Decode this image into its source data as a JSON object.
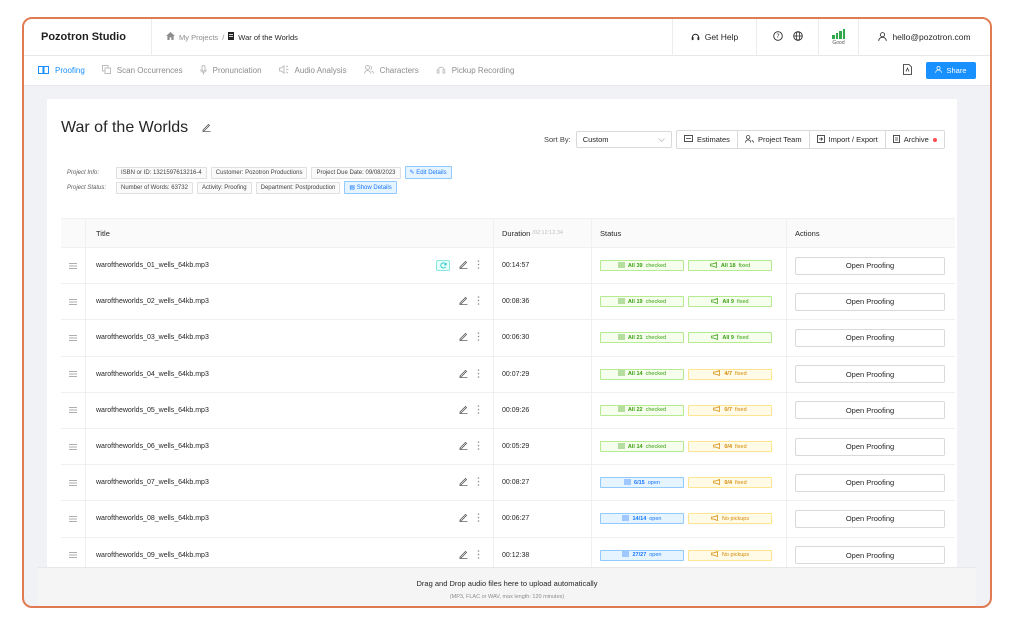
{
  "app": {
    "brand": "Pozotron Studio"
  },
  "breadcrumb": {
    "parent": "My Projects",
    "separator": "/",
    "current": "War of the Worlds"
  },
  "header": {
    "help_label": "Get Help",
    "signal_label": "Good",
    "user_email": "hello@pozotron.com"
  },
  "nav": {
    "items": [
      {
        "label": "Proofing",
        "icon": "book-icon",
        "active": true
      },
      {
        "label": "Scan Occurrences",
        "icon": "copy-icon",
        "active": false
      },
      {
        "label": "Pronunciation",
        "icon": "microphone-icon",
        "active": false
      },
      {
        "label": "Audio Analysis",
        "icon": "speaker-icon",
        "active": false
      },
      {
        "label": "Characters",
        "icon": "users-icon",
        "active": false
      },
      {
        "label": "Pickup Recording",
        "icon": "headphones-icon",
        "active": false
      }
    ],
    "share_label": "Share"
  },
  "project": {
    "title": "War of the Worlds",
    "info_label": "Project Info:",
    "info_tags": [
      "ISBN or ID: 1321597613216-4",
      "Customer: Pozotron Productions",
      "Project Due Date: 09/08/2023"
    ],
    "edit_details_label": "Edit Details",
    "status_label": "Project Status:",
    "status_tags": [
      "Number of Words: 63732",
      "Activity: Proofing",
      "Department: Postproduction"
    ],
    "show_details_label": "Show Details"
  },
  "toolbar": {
    "sort_label": "Sort By:",
    "sort_value": "Custom",
    "buttons": [
      "Estimates",
      "Project Team",
      "Import / Export",
      "Archive"
    ]
  },
  "table": {
    "headers": {
      "title": "Title",
      "duration": "Duration",
      "duration_total": "/02:12:12.34",
      "status": "Status",
      "actions": "Actions"
    },
    "action_label": "Open Proofing",
    "rows": [
      {
        "title": "waroftheworlds_01_wells_64kb.mp3",
        "duration": "00:14:57",
        "s1": {
          "tone": "green",
          "bold": "All 39",
          "rest": "checked"
        },
        "s2": {
          "tone": "green",
          "bold": "All 18",
          "rest": "fixed"
        },
        "refresh": true
      },
      {
        "title": "waroftheworlds_02_wells_64kb.mp3",
        "duration": "00:08:36",
        "s1": {
          "tone": "green",
          "bold": "All 19",
          "rest": "checked"
        },
        "s2": {
          "tone": "green",
          "bold": "All 9",
          "rest": "fixed"
        }
      },
      {
        "title": "waroftheworlds_03_wells_64kb.mp3",
        "duration": "00:06:30",
        "s1": {
          "tone": "green",
          "bold": "All 21",
          "rest": "checked"
        },
        "s2": {
          "tone": "green",
          "bold": "All 9",
          "rest": "fixed"
        }
      },
      {
        "title": "waroftheworlds_04_wells_64kb.mp3",
        "duration": "00:07:29",
        "s1": {
          "tone": "green",
          "bold": "All 14",
          "rest": "checked"
        },
        "s2": {
          "tone": "orange",
          "bold": "4/7",
          "rest": "fixed"
        }
      },
      {
        "title": "waroftheworlds_05_wells_64kb.mp3",
        "duration": "00:09:26",
        "s1": {
          "tone": "green",
          "bold": "All 22",
          "rest": "checked"
        },
        "s2": {
          "tone": "orange",
          "bold": "0/7",
          "rest": "fixed"
        }
      },
      {
        "title": "waroftheworlds_06_wells_64kb.mp3",
        "duration": "00:05:29",
        "s1": {
          "tone": "green",
          "bold": "All 14",
          "rest": "checked"
        },
        "s2": {
          "tone": "orange",
          "bold": "0/4",
          "rest": "fixed"
        }
      },
      {
        "title": "waroftheworlds_07_wells_64kb.mp3",
        "duration": "00:08:27",
        "s1": {
          "tone": "blue",
          "bold": "6/15",
          "rest": "open"
        },
        "s2": {
          "tone": "orange",
          "bold": "0/4",
          "rest": "fixed"
        }
      },
      {
        "title": "waroftheworlds_08_wells_64kb.mp3",
        "duration": "00:06:27",
        "s1": {
          "tone": "blue",
          "bold": "14/14",
          "rest": "open"
        },
        "s2": {
          "tone": "orange",
          "bold": "",
          "rest": "No pickups"
        }
      },
      {
        "title": "waroftheworlds_09_wells_64kb.mp3",
        "duration": "00:12:38",
        "s1": {
          "tone": "blue",
          "bold": "27/27",
          "rest": "open"
        },
        "s2": {
          "tone": "orange",
          "bold": "",
          "rest": "No pickups"
        }
      }
    ]
  },
  "dropzone": {
    "title": "Drag and Drop audio files here to upload automatically",
    "hint": "(MP3, FLAC or WAV, max length: 120 minutes)"
  },
  "colors": {
    "accent": "#1890ff",
    "frame": "#e07a52",
    "green": "#389e0d",
    "orange": "#d48806",
    "signal": "#2fa84a"
  }
}
